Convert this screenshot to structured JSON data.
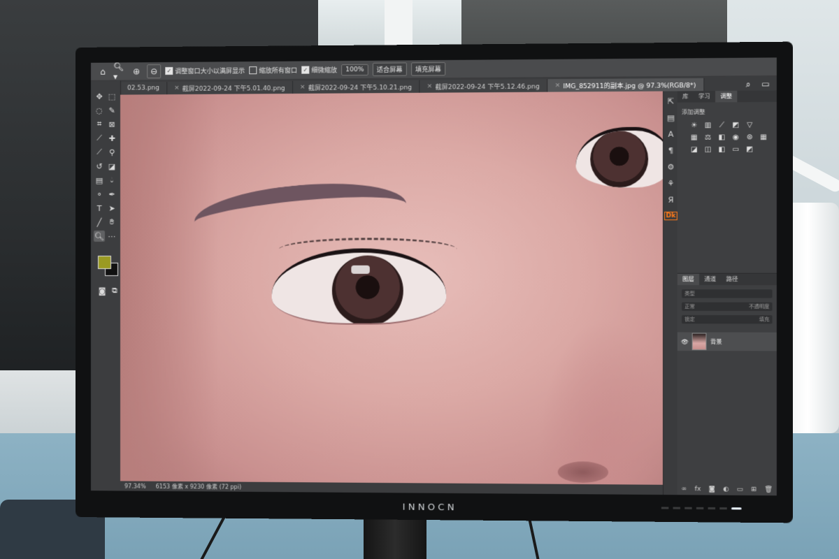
{
  "monitor": {
    "brand": "INNOCN"
  },
  "options_bar": {
    "home_icon": "home-icon",
    "zoom_icon": "zoom-tool-icon",
    "zoom_in_icon": "zoom-in-icon",
    "zoom_out_icon": "zoom-out-icon",
    "resize_windows_label": "调整窗口大小以满屏显示",
    "resize_windows_checked": true,
    "zoom_all_label": "缩放所有窗口",
    "zoom_all_checked": false,
    "scrubby_zoom_label": "细微缩放",
    "scrubby_zoom_checked": true,
    "btn_100": "100%",
    "btn_fit": "适合屏幕",
    "btn_fill": "填充屏幕"
  },
  "tabs": [
    {
      "label": "02.53.png",
      "active": false
    },
    {
      "label": "截屏2022-09-24 下午5.01.40.png",
      "active": false
    },
    {
      "label": "截屏2022-09-24 下午5.10.21.png",
      "active": false
    },
    {
      "label": "截屏2022-09-24 下午5.12.46.png",
      "active": false
    },
    {
      "label": "IMG_852911的副本.jpg @ 97.3%(RGB/8*)",
      "active": true
    }
  ],
  "status_bar": {
    "zoom": "97.34%",
    "dimensions": "6153 像素 x 9230 像素 (72 ppi)"
  },
  "right_panel": {
    "top_tabs": [
      "库",
      "学习",
      "调整"
    ],
    "adjust_title": "添加调整",
    "layer_tabs": [
      "图层",
      "通道",
      "路径"
    ],
    "filter_placeholder": "类型",
    "blend_mode": "正常",
    "opacity": "不透明度",
    "lock_label": "锁定",
    "fill_label": "填充",
    "layer_name": "背景"
  },
  "colors": {
    "foreground": "#9a9a22",
    "background": "#111111"
  }
}
